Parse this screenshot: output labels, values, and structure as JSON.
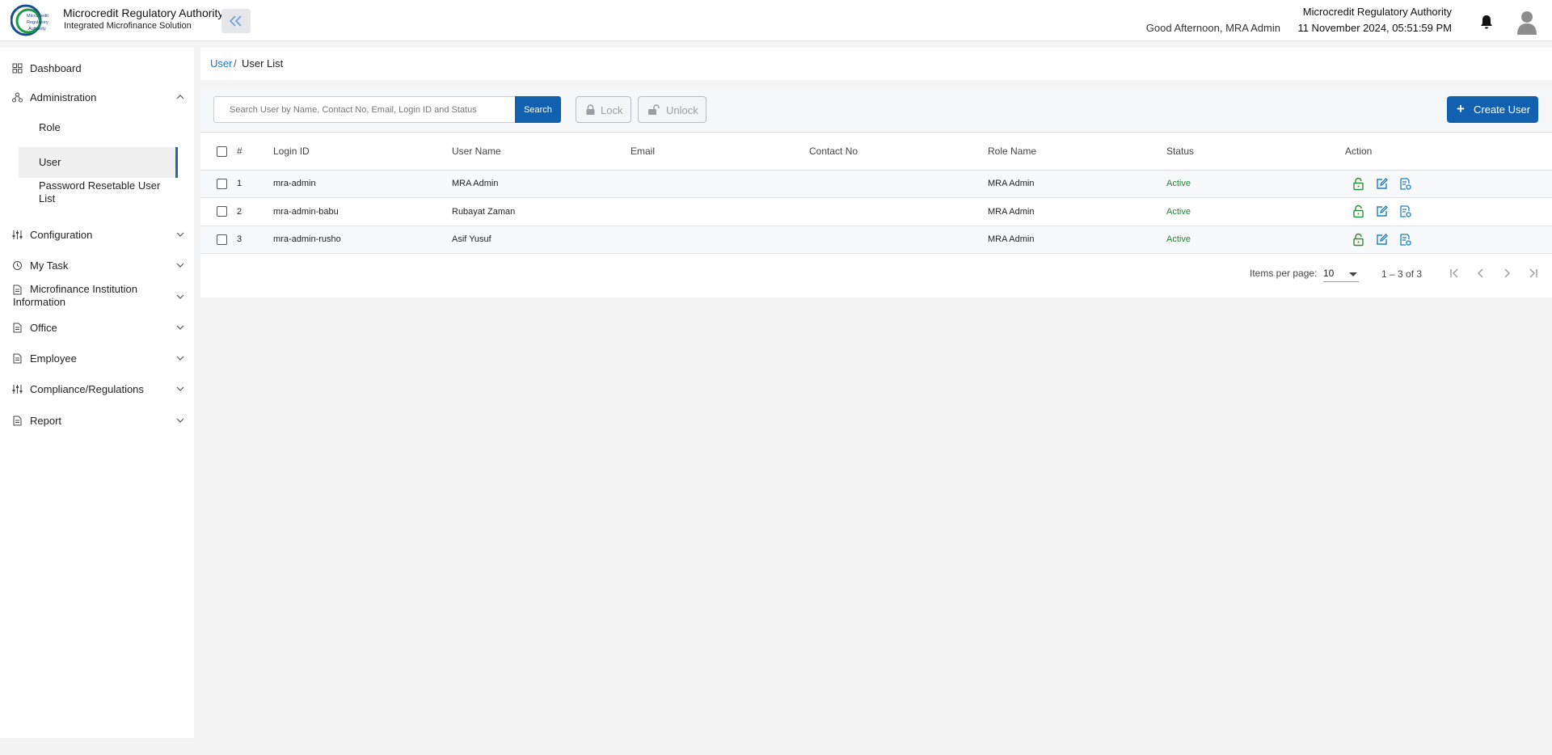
{
  "header": {
    "brand_title": "Microcredit Regulatory Authority",
    "brand_subtitle": "Integrated Microfinance Solution",
    "logo_text": [
      "Microcredit",
      "Regulatory",
      "Authority"
    ],
    "greeting": "Good Afternoon, MRA Admin",
    "org_name": "Microcredit Regulatory Authority",
    "datetime": "11 November 2024, 05:51:59 PM"
  },
  "sidebar": {
    "items": [
      {
        "label": "Dashboard",
        "icon": "grid-icon"
      },
      {
        "label": "Administration",
        "icon": "admin-icon",
        "expanded": true,
        "children": [
          {
            "label": "Role"
          },
          {
            "label": "User",
            "active": true
          },
          {
            "label": "Password Resetable User List"
          }
        ]
      },
      {
        "label": "Configuration",
        "icon": "sliders-icon"
      },
      {
        "label": "My Task",
        "icon": "task-icon"
      },
      {
        "label": "Microfinance Institution Information",
        "icon": "document-icon"
      },
      {
        "label": "Office",
        "icon": "document-icon"
      },
      {
        "label": "Employee",
        "icon": "document-icon"
      },
      {
        "label": "Compliance/Regulations",
        "icon": "sliders-icon"
      },
      {
        "label": "Report",
        "icon": "document-icon"
      }
    ]
  },
  "breadcrumb": {
    "parent": "User",
    "separator": "/",
    "current": "User List"
  },
  "toolbar": {
    "search_placeholder": "Search User by Name, Contact No, Email, Login ID and Status",
    "search_label": "Search",
    "lock_label": "Lock",
    "unlock_label": "Unlock",
    "create_label": "Create User"
  },
  "table": {
    "columns": [
      "#",
      "Login ID",
      "User Name",
      "Email",
      "Contact No",
      "Role Name",
      "Status",
      "Action"
    ],
    "rows": [
      {
        "num": "1",
        "login_id": "mra-admin",
        "user_name": "MRA Admin",
        "email": "",
        "contact_no": "",
        "role_name": "MRA Admin",
        "status": "Active"
      },
      {
        "num": "2",
        "login_id": "mra-admin-babu",
        "user_name": "Rubayat Zaman",
        "email": "",
        "contact_no": "",
        "role_name": "MRA Admin",
        "status": "Active"
      },
      {
        "num": "3",
        "login_id": "mra-admin-rusho",
        "user_name": "Asif Yusuf",
        "email": "",
        "contact_no": "",
        "role_name": "MRA Admin",
        "status": "Active"
      }
    ]
  },
  "paginator": {
    "items_per_page_label": "Items per page:",
    "items_per_page": "10",
    "range": "1 – 3 of 3"
  },
  "colors": {
    "primary": "#1261b0",
    "link": "#1e73d1",
    "active_status": "#1d8a2f",
    "action_icon": "#1a7fc1",
    "lock_icon": "#2e8b3a"
  }
}
